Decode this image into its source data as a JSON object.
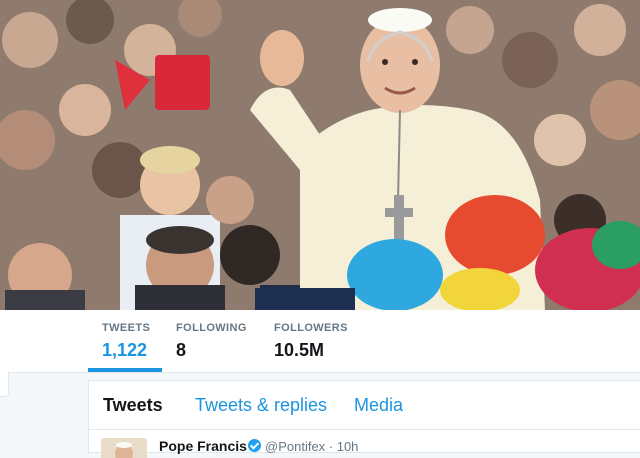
{
  "profile": {
    "header_image": "Pope Francis waving to crowd in St. Peter's Square"
  },
  "stats": [
    {
      "label": "TWEETS",
      "value": "1,122",
      "active": true
    },
    {
      "label": "FOLLOWING",
      "value": "8",
      "active": false
    },
    {
      "label": "FOLLOWERS",
      "value": "10.5M",
      "active": false
    }
  ],
  "tabs": [
    {
      "label": "Tweets",
      "active": true
    },
    {
      "label": "Tweets & replies",
      "active": false
    },
    {
      "label": "Media",
      "active": false
    }
  ],
  "tweet": {
    "name": "Pope Francis",
    "handle": "@Pontifex · 10h",
    "verified": true
  },
  "colors": {
    "accent": "#1b95e0",
    "text": "#14171a",
    "muted": "#657786",
    "border": "#e1e8ed"
  }
}
